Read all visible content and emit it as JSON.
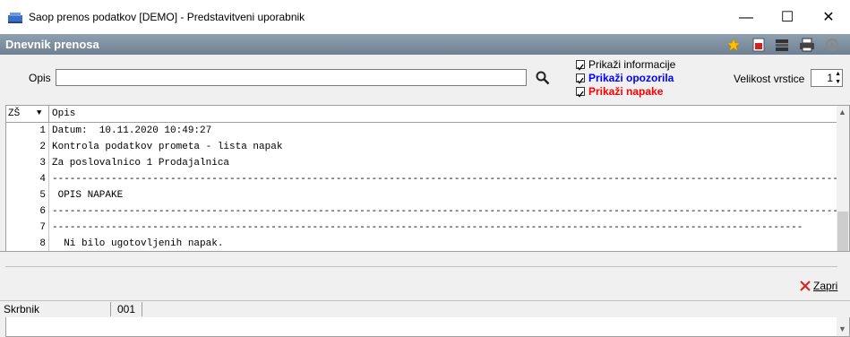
{
  "window": {
    "title": "Saop prenos podatkov [DEMO] - Predstavitveni uporabnik",
    "minimize": "—",
    "maximize": "☐",
    "close": "✕"
  },
  "header": {
    "title": "Dnevnik prenosa",
    "icons": [
      "star-icon",
      "pdf-export-icon",
      "stack-icon",
      "print-icon",
      "settings-icon"
    ]
  },
  "filter": {
    "opis_label": "Opis",
    "opis_value": "",
    "checkboxes": [
      {
        "label": "Prikaži informacije",
        "checked": true,
        "color": "#000000"
      },
      {
        "label": "Prikaži opozorila",
        "checked": true,
        "color": "#0000ff"
      },
      {
        "label": "Prikaži napake",
        "checked": true,
        "color": "#ff0000"
      }
    ],
    "row_size_label": "Velikost vrstice",
    "row_size_value": "1"
  },
  "grid": {
    "columns": [
      "ZŠ",
      "Opis"
    ],
    "rows": [
      {
        "num": "1",
        "text": "Datum:  10.11.2020 10:49:27"
      },
      {
        "num": "2",
        "text": "Kontrola podatkov prometa - lista napak"
      },
      {
        "num": "3",
        "text": "Za poslovalnico 1 Prodajalnica"
      },
      {
        "num": "4",
        "text": "---------------------------------------------------------------------------------------------------------------------------------------------"
      },
      {
        "num": "5",
        "text": " OPIS NAPAKE"
      },
      {
        "num": "6",
        "text": "---------------------------------------------------------------------------------------------------------------------------------------------"
      },
      {
        "num": "7",
        "text": "-------------------------------------------------------------------------------------------------------------------------------"
      },
      {
        "num": "8",
        "text": "  Ni bilo ugotovljenih napak."
      }
    ]
  },
  "footer": {
    "close_label": "Zapri"
  },
  "status": {
    "user": "Skrbnik",
    "code": "001"
  }
}
